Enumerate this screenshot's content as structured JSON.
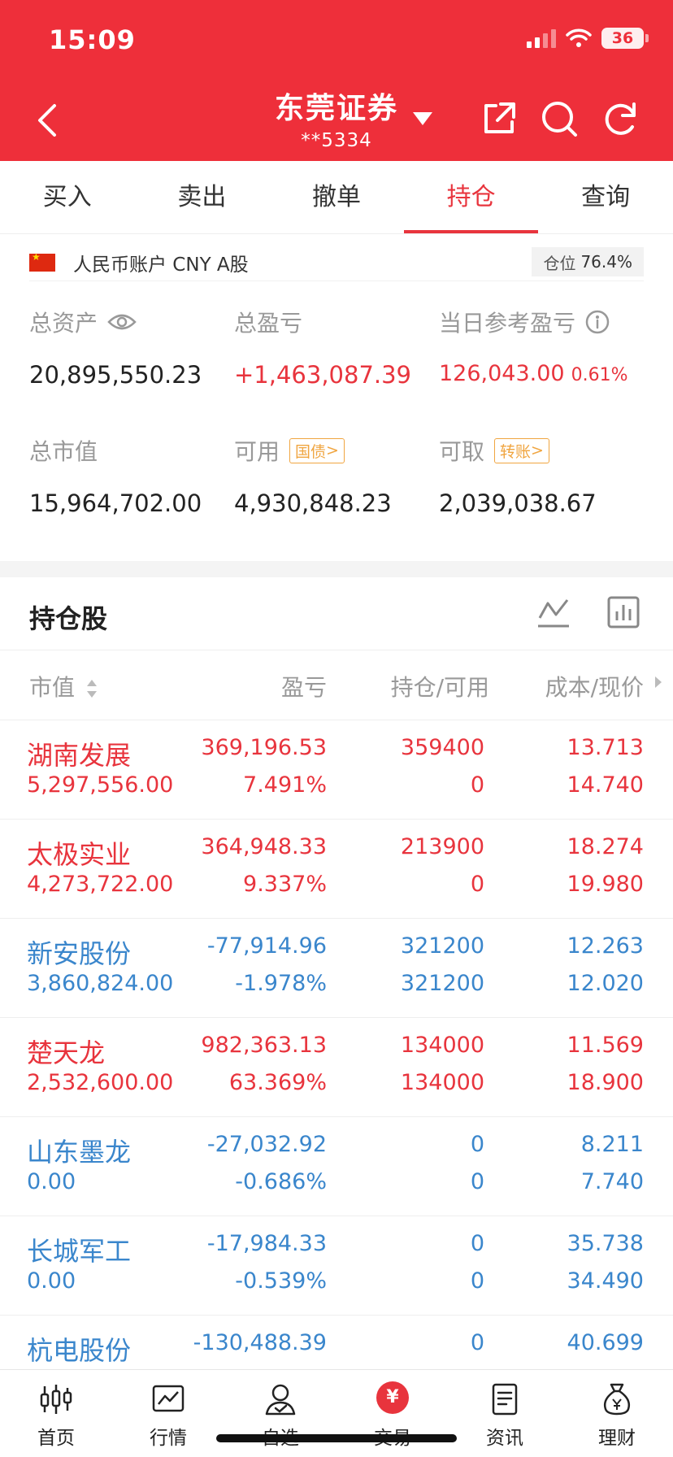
{
  "status_bar": {
    "time": "15:09",
    "battery": "36"
  },
  "header": {
    "broker": "东莞证券",
    "account": "**5334"
  },
  "tabs": [
    {
      "label": "买入",
      "active": false
    },
    {
      "label": "卖出",
      "active": false
    },
    {
      "label": "撤单",
      "active": false
    },
    {
      "label": "持仓",
      "active": true
    },
    {
      "label": "查询",
      "active": false
    }
  ],
  "account": {
    "label": "人民币账户 CNY A股",
    "position_label": "仓位",
    "position_value": "76.4%"
  },
  "stats": {
    "total_assets": {
      "label": "总资产",
      "value": "20,895,550.23"
    },
    "total_pl": {
      "label": "总盈亏",
      "value": "+1,463,087.39"
    },
    "daily_pl": {
      "label": "当日参考盈亏",
      "value": "126,043.00",
      "pct": "0.61%"
    },
    "market_value": {
      "label": "总市值",
      "value": "15,964,702.00"
    },
    "available": {
      "label": "可用",
      "tag": "国债",
      "value": "4,930,848.23"
    },
    "withdrawable": {
      "label": "可取",
      "tag": "转账",
      "value": "2,039,038.67"
    }
  },
  "holdings": {
    "title": "持仓股",
    "columns": {
      "market_value": "市值",
      "pl": "盈亏",
      "holding": "持仓/可用",
      "cost_price": "成本/现价"
    },
    "rows": [
      {
        "name": "湖南发展",
        "market_value": "5,297,556.00",
        "pl": "369,196.53",
        "pl_pct": "7.491%",
        "holding": "359400",
        "available": "0",
        "cost": "13.713",
        "price": "14.740",
        "trend": "up"
      },
      {
        "name": "太极实业",
        "market_value": "4,273,722.00",
        "pl": "364,948.33",
        "pl_pct": "9.337%",
        "holding": "213900",
        "available": "0",
        "cost": "18.274",
        "price": "19.980",
        "trend": "up"
      },
      {
        "name": "新安股份",
        "market_value": "3,860,824.00",
        "pl": "-77,914.96",
        "pl_pct": "-1.978%",
        "holding": "321200",
        "available": "321200",
        "cost": "12.263",
        "price": "12.020",
        "trend": "down"
      },
      {
        "name": "楚天龙",
        "market_value": "2,532,600.00",
        "pl": "982,363.13",
        "pl_pct": "63.369%",
        "holding": "134000",
        "available": "134000",
        "cost": "11.569",
        "price": "18.900",
        "trend": "up"
      },
      {
        "name": "山东墨龙",
        "market_value": "0.00",
        "pl": "-27,032.92",
        "pl_pct": "-0.686%",
        "holding": "0",
        "available": "0",
        "cost": "8.211",
        "price": "7.740",
        "trend": "down"
      },
      {
        "name": "长城军工",
        "market_value": "0.00",
        "pl": "-17,984.33",
        "pl_pct": "-0.539%",
        "holding": "0",
        "available": "0",
        "cost": "35.738",
        "price": "34.490",
        "trend": "down"
      },
      {
        "name": "杭电股份",
        "market_value": "",
        "pl": "-130,488.39",
        "pl_pct": "",
        "holding": "0",
        "available": "",
        "cost": "40.699",
        "price": "",
        "trend": "down"
      }
    ]
  },
  "bottom_nav": [
    {
      "label": "首页",
      "icon": "candlestick-icon"
    },
    {
      "label": "行情",
      "icon": "line-chart-icon"
    },
    {
      "label": "自选",
      "icon": "user-check-icon"
    },
    {
      "label": "交易",
      "icon": "yuan-icon"
    },
    {
      "label": "资讯",
      "icon": "document-icon"
    },
    {
      "label": "理财",
      "icon": "money-bag-icon"
    }
  ],
  "colors": {
    "brand": "#ee2f3a",
    "up": "#e8343d",
    "down": "#3a86cc",
    "tag": "#f0a540"
  }
}
